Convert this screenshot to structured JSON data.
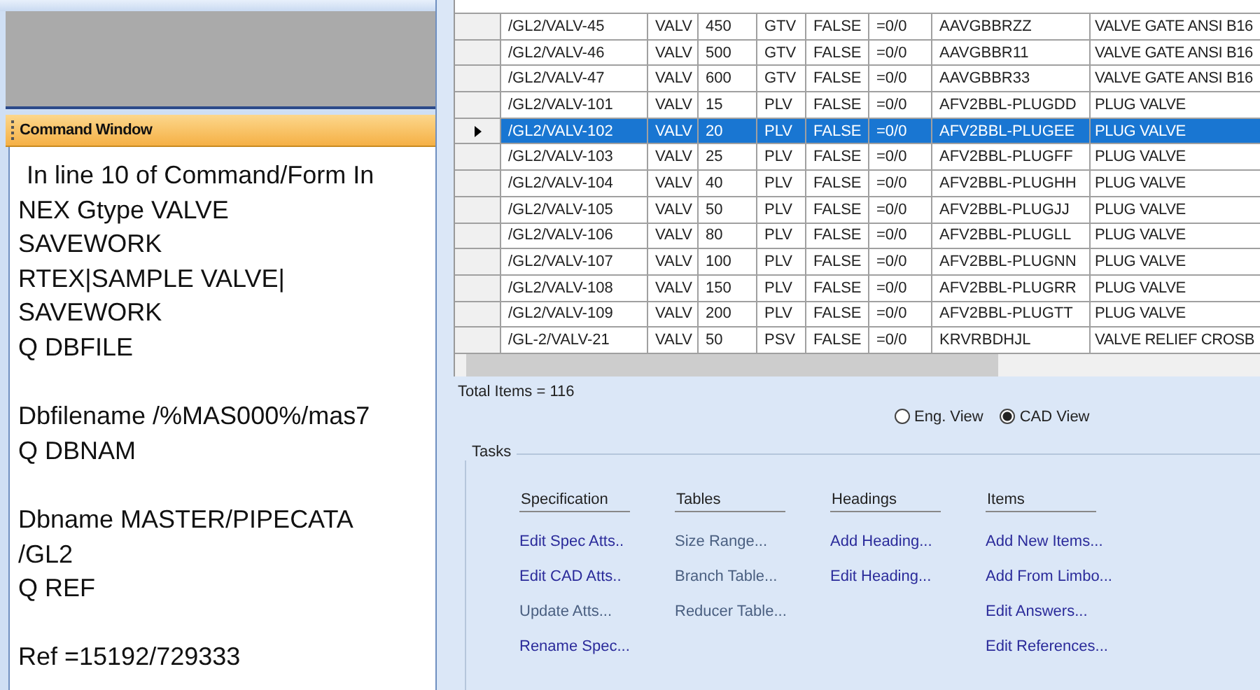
{
  "command_window": {
    "title": "Command Window",
    "lines": [
      {
        "text": "In line 10 of Command/Form In",
        "gap_before": false
      },
      {
        "text": "NEX Gtype VALVE",
        "gap_before": false
      },
      {
        "text": "SAVEWORK",
        "gap_before": false
      },
      {
        "text": "RTEX|SAMPLE VALVE|",
        "gap_before": false
      },
      {
        "text": "SAVEWORK",
        "gap_before": false
      },
      {
        "text": "Q DBFILE",
        "gap_before": false
      },
      {
        "text": "Dbfilename /%MAS000%/mas7",
        "gap_before": true
      },
      {
        "text": "Q DBNAM",
        "gap_before": false
      },
      {
        "text": "Dbname MASTER/PIPECATA",
        "gap_before": true
      },
      {
        "text": "/GL2",
        "gap_before": false
      },
      {
        "text": "Q REF",
        "gap_before": false
      },
      {
        "text": "Ref =15192/729333",
        "gap_before": true
      }
    ]
  },
  "table": {
    "rows": [
      {
        "selected": false,
        "cells": [
          "/GL2/VALV-45",
          "VALV",
          "450",
          "GTV",
          "FALSE",
          "=0/0",
          "AAVGBBRZZ",
          "VALVE GATE ANSI B16"
        ]
      },
      {
        "selected": false,
        "cells": [
          "/GL2/VALV-46",
          "VALV",
          "500",
          "GTV",
          "FALSE",
          "=0/0",
          "AAVGBBR11",
          "VALVE GATE ANSI B16"
        ]
      },
      {
        "selected": false,
        "cells": [
          "/GL2/VALV-47",
          "VALV",
          "600",
          "GTV",
          "FALSE",
          "=0/0",
          "AAVGBBR33",
          "VALVE GATE ANSI B16"
        ]
      },
      {
        "selected": false,
        "cells": [
          "/GL2/VALV-101",
          "VALV",
          "15",
          "PLV",
          "FALSE",
          "=0/0",
          "AFV2BBL-PLUGDD",
          "PLUG VALVE"
        ]
      },
      {
        "selected": true,
        "cells": [
          "/GL2/VALV-102",
          "VALV",
          "20",
          "PLV",
          "FALSE",
          "=0/0",
          "AFV2BBL-PLUGEE",
          "PLUG VALVE"
        ]
      },
      {
        "selected": false,
        "cells": [
          "/GL2/VALV-103",
          "VALV",
          "25",
          "PLV",
          "FALSE",
          "=0/0",
          "AFV2BBL-PLUGFF",
          "PLUG VALVE"
        ]
      },
      {
        "selected": false,
        "cells": [
          "/GL2/VALV-104",
          "VALV",
          "40",
          "PLV",
          "FALSE",
          "=0/0",
          "AFV2BBL-PLUGHH",
          "PLUG VALVE"
        ]
      },
      {
        "selected": false,
        "cells": [
          "/GL2/VALV-105",
          "VALV",
          "50",
          "PLV",
          "FALSE",
          "=0/0",
          "AFV2BBL-PLUGJJ",
          "PLUG VALVE"
        ]
      },
      {
        "selected": false,
        "cells": [
          "/GL2/VALV-106",
          "VALV",
          "80",
          "PLV",
          "FALSE",
          "=0/0",
          "AFV2BBL-PLUGLL",
          "PLUG VALVE"
        ]
      },
      {
        "selected": false,
        "cells": [
          "/GL2/VALV-107",
          "VALV",
          "100",
          "PLV",
          "FALSE",
          "=0/0",
          "AFV2BBL-PLUGNN",
          "PLUG VALVE"
        ]
      },
      {
        "selected": false,
        "cells": [
          "/GL2/VALV-108",
          "VALV",
          "150",
          "PLV",
          "FALSE",
          "=0/0",
          "AFV2BBL-PLUGRR",
          "PLUG VALVE"
        ]
      },
      {
        "selected": false,
        "cells": [
          "/GL2/VALV-109",
          "VALV",
          "200",
          "PLV",
          "FALSE",
          "=0/0",
          "AFV2BBL-PLUGTT",
          "PLUG VALVE"
        ]
      },
      {
        "selected": false,
        "cells": [
          "/GL-2/VALV-21",
          "VALV",
          "50",
          "PSV",
          "FALSE",
          "=0/0",
          "KRVRBDHJL",
          "VALVE RELIEF CROSB"
        ]
      }
    ]
  },
  "total_items": "Total Items = 116",
  "view_options": [
    {
      "label": "Eng. View",
      "selected": false
    },
    {
      "label": "CAD View",
      "selected": true
    }
  ],
  "tasks": {
    "title": "Tasks",
    "groups": [
      {
        "heading": "Specification",
        "links": [
          {
            "label": "Edit Spec Atts..",
            "disabled": false
          },
          {
            "label": "Edit CAD Atts..",
            "disabled": false
          },
          {
            "label": "Update Atts...",
            "disabled": true
          },
          {
            "label": "Rename Spec...",
            "disabled": false
          }
        ]
      },
      {
        "heading": "Tables",
        "links": [
          {
            "label": "Size Range...",
            "disabled": true
          },
          {
            "label": "Branch Table...",
            "disabled": true
          },
          {
            "label": "Reducer Table...",
            "disabled": true
          }
        ]
      },
      {
        "heading": "Headings",
        "links": [
          {
            "label": "Add Heading...",
            "disabled": false
          },
          {
            "label": "Edit Heading...",
            "disabled": false
          }
        ]
      },
      {
        "heading": "Items",
        "links": [
          {
            "label": "Add New Items...",
            "disabled": false
          },
          {
            "label": "Add From Limbo...",
            "disabled": false
          },
          {
            "label": "Edit Answers...",
            "disabled": false
          },
          {
            "label": "Edit References...",
            "disabled": false
          }
        ]
      }
    ]
  }
}
